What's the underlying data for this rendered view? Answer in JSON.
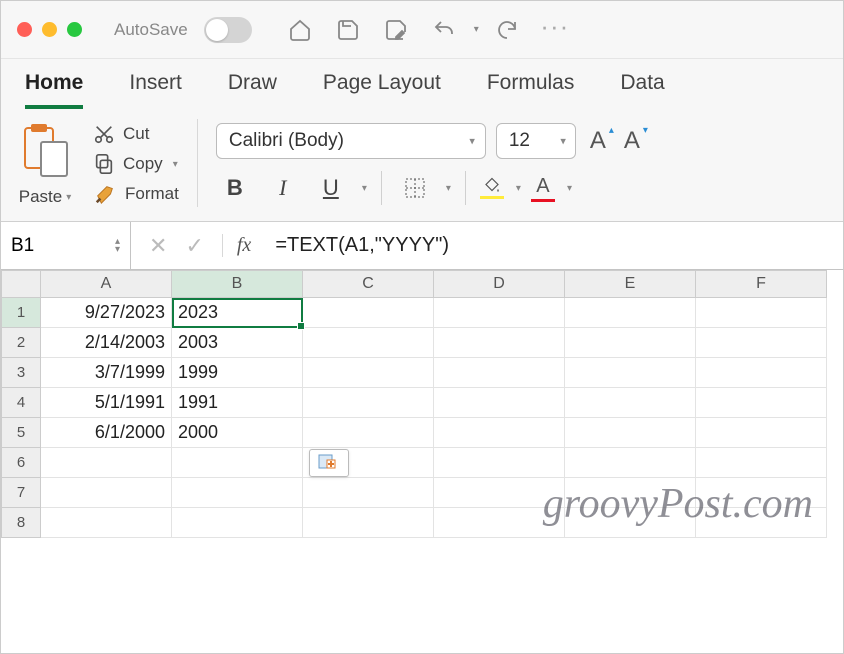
{
  "titlebar": {
    "autosave_label": "AutoSave"
  },
  "tabs": [
    "Home",
    "Insert",
    "Draw",
    "Page Layout",
    "Formulas",
    "Data"
  ],
  "active_tab": "Home",
  "ribbon": {
    "paste_label": "Paste",
    "cut_label": "Cut",
    "copy_label": "Copy",
    "format_label": "Format",
    "font_name": "Calibri (Body)",
    "font_size": "12",
    "increase_font": "A",
    "decrease_font": "A",
    "bold": "B",
    "italic": "I",
    "underline": "U",
    "font_color_letter": "A"
  },
  "formula_bar": {
    "cell_ref": "B1",
    "fx_label": "fx",
    "formula": "=TEXT(A1,\"YYYY\")"
  },
  "columns": [
    "A",
    "B",
    "C",
    "D",
    "E",
    "F"
  ],
  "row_count": 8,
  "selected_cell": "B1",
  "cells": {
    "A1": "9/27/2023",
    "B1": "2023",
    "A2": "2/14/2003",
    "B2": "2003",
    "A3": "3/7/1999",
    "B3": "1999",
    "A4": "5/1/1991",
    "B4": "1991",
    "A5": "6/1/2000",
    "B5": "2000"
  },
  "watermark": "groovyPost.com"
}
